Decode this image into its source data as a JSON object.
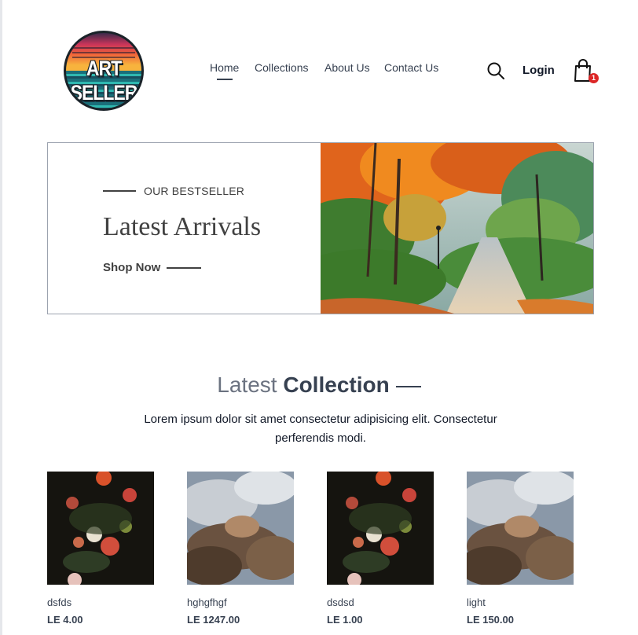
{
  "brand": {
    "logo_text": "ART SELLER"
  },
  "nav": {
    "items": [
      {
        "label": "Home",
        "active": true
      },
      {
        "label": "Collections",
        "active": false
      },
      {
        "label": "About Us",
        "active": false
      },
      {
        "label": "Contact Us",
        "active": false
      }
    ],
    "login_label": "Login",
    "cart_count": "1",
    "icons": [
      "search-icon",
      "cart-icon"
    ]
  },
  "hero": {
    "eyebrow": "OUR BESTSELLER",
    "title": "Latest Arrivals",
    "cta_label": "Shop Now",
    "image": "autumn forest path painting"
  },
  "collection": {
    "title_light": "Latest",
    "title_bold": "Collection",
    "description": "Lorem ipsum dolor sit amet consectetur adipisicing elit. Consectetur perferendis modi.",
    "products": [
      {
        "name": "dsfds",
        "price": "LE 4.00",
        "image": "flower still-life painting"
      },
      {
        "name": "hghgfhgf",
        "price": "LE 1247.00",
        "image": "baroque ceiling fresco"
      },
      {
        "name": "dsdsd",
        "price": "LE 1.00",
        "image": "flower still-life painting"
      },
      {
        "name": "light",
        "price": "LE 150.00",
        "image": "baroque ceiling fresco"
      }
    ]
  },
  "colors": {
    "text_dark": "#414141",
    "badge": "#dc2626",
    "hero_border": "#9ca3af"
  }
}
